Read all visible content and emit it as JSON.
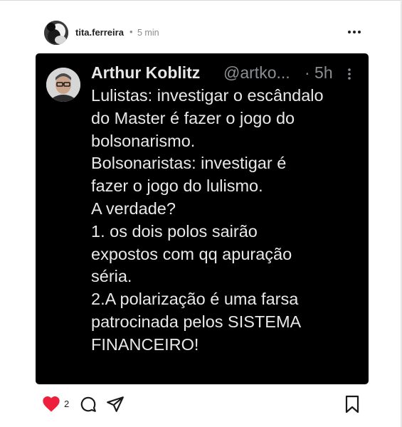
{
  "post": {
    "username": "tita.ferreira",
    "separator": "•",
    "time": "5 min",
    "more_icon": "more-horizontal-icon"
  },
  "tweet": {
    "name": "Arthur Koblitz",
    "handle": "@artko...",
    "time": "· 5h",
    "text": "Lulistas: investigar o escândalo\ndo Master é fazer o jogo do\nbolsonarismo.\nBolsonaristas: investigar é\nfazer o jogo do lulismo.\nA verdade?\n1. os dois polos sairão\nexpostos com qq apuração\nséria.\n2.A polarização é uma farsa\npatrocinada pelos SISTEMA\nFINANCEIRO!"
  },
  "actions": {
    "like_count": "2",
    "like_color": "#ed1f3c",
    "icons": [
      "heart-icon",
      "comment-icon",
      "share-icon",
      "bookmark-icon"
    ]
  }
}
